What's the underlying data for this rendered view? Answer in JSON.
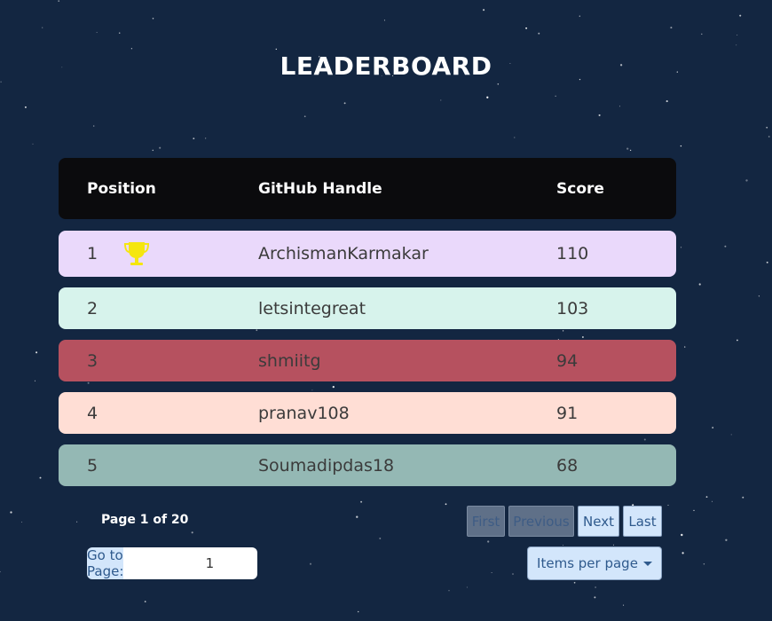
{
  "title": "LEADERBOARD",
  "table": {
    "headers": {
      "position": "Position",
      "handle": "GitHub Handle",
      "score": "Score"
    },
    "rows": [
      {
        "position": "1",
        "handle": "ArchismanKarmakar",
        "score": "110",
        "color": "#ead9fb",
        "trophy": true
      },
      {
        "position": "2",
        "handle": "letsintegreat",
        "score": "103",
        "color": "#d7f3ec"
      },
      {
        "position": "3",
        "handle": "shmiitg",
        "score": "94",
        "color": "#b6515f"
      },
      {
        "position": "4",
        "handle": "pranav108",
        "score": "91",
        "color": "#ffded5"
      },
      {
        "position": "5",
        "handle": "Soumadipdas18",
        "score": "68",
        "color": "#94b8b4"
      }
    ]
  },
  "pagination": {
    "info": "Page 1 of 20",
    "first": "First",
    "previous": "Previous",
    "next": "Next",
    "last": "Last",
    "goto_label": "Go to Page:",
    "goto_value": "1",
    "items_per_page": "Items per page"
  },
  "colors": {
    "background": "#132641",
    "header_bg": "#0b0b0d",
    "button_bg": "#d3e6fb",
    "button_text": "#2f5a8d",
    "trophy": "#f5e60f"
  }
}
